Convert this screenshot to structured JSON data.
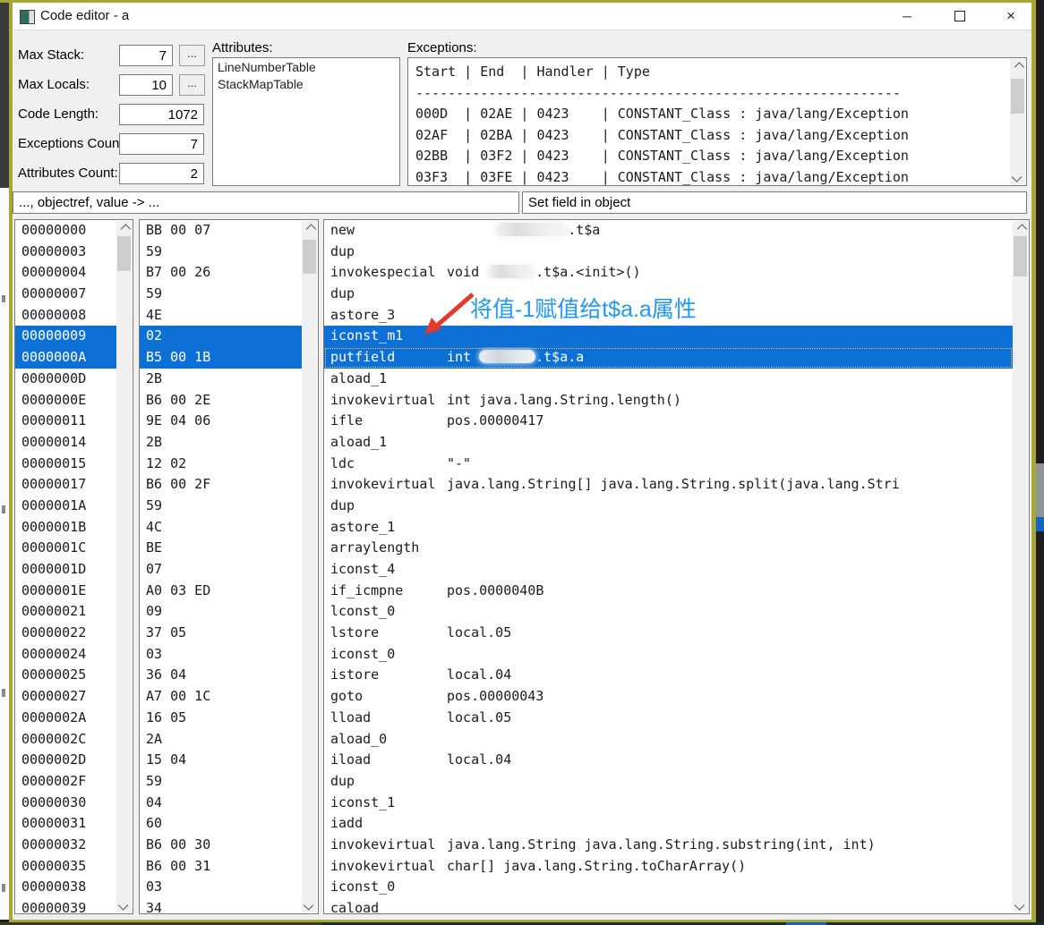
{
  "window": {
    "title": "Code editor - a",
    "controls": {
      "minimize": "─",
      "maximize": "",
      "close": "×"
    }
  },
  "form": {
    "fields": [
      {
        "label": "Max Stack:",
        "value": "7",
        "browse": "..."
      },
      {
        "label": "Max Locals:",
        "value": "10",
        "browse": "..."
      },
      {
        "label": "Code Length:",
        "value": "1072"
      },
      {
        "label": "Exceptions Count:",
        "value": "7"
      },
      {
        "label": "Attributes Count:",
        "value": "2"
      }
    ]
  },
  "attributes": {
    "label": "Attributes:",
    "items": [
      "LineNumberTable",
      "StackMapTable"
    ]
  },
  "exceptions": {
    "label": "Exceptions:",
    "columns": [
      "Start",
      "End",
      "Handler",
      "Type"
    ],
    "rows": [
      {
        "start": "000D",
        "end": "02AE",
        "handler": "0423",
        "type": "CONSTANT_Class : java/lang/Exception"
      },
      {
        "start": "02AF",
        "end": "02BA",
        "handler": "0423",
        "type": "CONSTANT_Class : java/lang/Exception"
      },
      {
        "start": "02BB",
        "end": "03F2",
        "handler": "0423",
        "type": "CONSTANT_Class : java/lang/Exception"
      },
      {
        "start": "03F3",
        "end": "03FE",
        "handler": "0423",
        "type": "CONSTANT_Class : java/lang/Exception"
      }
    ]
  },
  "stack_effect": "..., objectref, value -> ...",
  "description": "Set field in object",
  "annotation": {
    "text": "将值-1赋值给t$a.a属性",
    "color": "#1e9af2",
    "arrow_color": "#e23b2e"
  },
  "code": {
    "rows": [
      {
        "offset": "00000000",
        "hex": "BB 00 07",
        "mnemonic": "new",
        "operand": [
          {
            "text": "      "
          },
          {
            "blur": 9
          },
          {
            "text": ".t$a"
          }
        ]
      },
      {
        "offset": "00000003",
        "hex": "59",
        "mnemonic": "dup",
        "operand": []
      },
      {
        "offset": "00000004",
        "hex": "B7 00 26",
        "mnemonic": "invokespecial",
        "operand": [
          {
            "text": "void "
          },
          {
            "blur": 6
          },
          {
            "text": ".t$a.<init>()"
          }
        ]
      },
      {
        "offset": "00000007",
        "hex": "59",
        "mnemonic": "dup",
        "operand": []
      },
      {
        "offset": "00000008",
        "hex": "4E",
        "mnemonic": "astore_3",
        "operand": []
      },
      {
        "offset": "00000009",
        "hex": "02",
        "mnemonic": "iconst_m1",
        "operand": [],
        "selected": true
      },
      {
        "offset": "0000000A",
        "hex": "B5 00 1B",
        "mnemonic": "putfield",
        "operand": [
          {
            "text": "int "
          },
          {
            "blur": 7
          },
          {
            "text": ".t$a.a"
          }
        ],
        "selected": true,
        "focused": true
      },
      {
        "offset": "0000000D",
        "hex": "2B",
        "mnemonic": "aload_1",
        "operand": []
      },
      {
        "offset": "0000000E",
        "hex": "B6 00 2E",
        "mnemonic": "invokevirtual",
        "operand": [
          {
            "text": "int java.lang.String.length()"
          }
        ]
      },
      {
        "offset": "00000011",
        "hex": "9E 04 06",
        "mnemonic": "ifle",
        "operand": [
          {
            "text": "pos.00000417"
          }
        ]
      },
      {
        "offset": "00000014",
        "hex": "2B",
        "mnemonic": "aload_1",
        "operand": []
      },
      {
        "offset": "00000015",
        "hex": "12 02",
        "mnemonic": "ldc",
        "operand": [
          {
            "text": "\"-\""
          }
        ]
      },
      {
        "offset": "00000017",
        "hex": "B6 00 2F",
        "mnemonic": "invokevirtual",
        "operand": [
          {
            "text": "java.lang.String[] java.lang.String.split(java.lang.Stri"
          }
        ]
      },
      {
        "offset": "0000001A",
        "hex": "59",
        "mnemonic": "dup",
        "operand": []
      },
      {
        "offset": "0000001B",
        "hex": "4C",
        "mnemonic": "astore_1",
        "operand": []
      },
      {
        "offset": "0000001C",
        "hex": "BE",
        "mnemonic": "arraylength",
        "operand": []
      },
      {
        "offset": "0000001D",
        "hex": "07",
        "mnemonic": "iconst_4",
        "operand": []
      },
      {
        "offset": "0000001E",
        "hex": "A0 03 ED",
        "mnemonic": "if_icmpne",
        "operand": [
          {
            "text": "pos.0000040B"
          }
        ]
      },
      {
        "offset": "00000021",
        "hex": "09",
        "mnemonic": "lconst_0",
        "operand": []
      },
      {
        "offset": "00000022",
        "hex": "37 05",
        "mnemonic": "lstore",
        "operand": [
          {
            "text": "local.05"
          }
        ]
      },
      {
        "offset": "00000024",
        "hex": "03",
        "mnemonic": "iconst_0",
        "operand": []
      },
      {
        "offset": "00000025",
        "hex": "36 04",
        "mnemonic": "istore",
        "operand": [
          {
            "text": "local.04"
          }
        ]
      },
      {
        "offset": "00000027",
        "hex": "A7 00 1C",
        "mnemonic": "goto",
        "operand": [
          {
            "text": "pos.00000043"
          }
        ]
      },
      {
        "offset": "0000002A",
        "hex": "16 05",
        "mnemonic": "lload",
        "operand": [
          {
            "text": "local.05"
          }
        ]
      },
      {
        "offset": "0000002C",
        "hex": "2A",
        "mnemonic": "aload_0",
        "operand": []
      },
      {
        "offset": "0000002D",
        "hex": "15 04",
        "mnemonic": "iload",
        "operand": [
          {
            "text": "local.04"
          }
        ]
      },
      {
        "offset": "0000002F",
        "hex": "59",
        "mnemonic": "dup",
        "operand": []
      },
      {
        "offset": "00000030",
        "hex": "04",
        "mnemonic": "iconst_1",
        "operand": []
      },
      {
        "offset": "00000031",
        "hex": "60",
        "mnemonic": "iadd",
        "operand": []
      },
      {
        "offset": "00000032",
        "hex": "B6 00 30",
        "mnemonic": "invokevirtual",
        "operand": [
          {
            "text": "java.lang.String java.lang.String.substring(int, int)"
          }
        ]
      },
      {
        "offset": "00000035",
        "hex": "B6 00 31",
        "mnemonic": "invokevirtual",
        "operand": [
          {
            "text": "char[] java.lang.String.toCharArray()"
          }
        ]
      },
      {
        "offset": "00000038",
        "hex": "03",
        "mnemonic": "iconst_0",
        "operand": []
      },
      {
        "offset": "00000039",
        "hex": "34",
        "mnemonic": "caload",
        "operand": []
      }
    ]
  }
}
